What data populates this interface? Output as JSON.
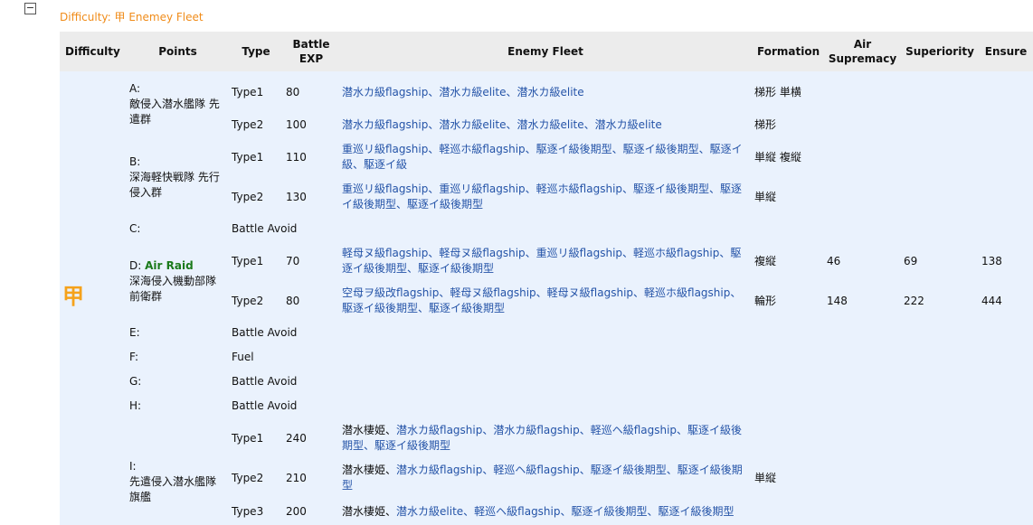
{
  "toggle_symbol": "−",
  "difficulty_title": "Difficulty: 甲 Enemey Fleet",
  "headers": {
    "difficulty": "Difficulty",
    "points": "Points",
    "type": "Type",
    "battle_exp": "Battle EXP",
    "enemy_fleet": "Enemy Fleet",
    "formation": "Formation",
    "air_supremacy": "Air Supremacy",
    "superiority": "Superiority",
    "ensure": "Ensure"
  },
  "difficulty_label": "甲",
  "points": {
    "A": {
      "line1": "A:",
      "name": "敵侵入潜水艦隊 先遣群"
    },
    "B": {
      "line1": "B:",
      "name": "深海軽快戦隊 先行侵入群"
    },
    "C": {
      "line1": "C:"
    },
    "D": {
      "line1": "D:",
      "tag": "Air Raid",
      "name": "深海侵入機動部隊 前衛群"
    },
    "E": {
      "line1": "E:"
    },
    "F": {
      "line1": "F:"
    },
    "G": {
      "line1": "G:"
    },
    "H": {
      "line1": "H:"
    },
    "I": {
      "line1": "I:",
      "name": "先遣侵入潜水艦隊 旗艦"
    }
  },
  "rows": {
    "a1": {
      "type": "Type1",
      "exp": "80",
      "fleet": "潜水カ級flagship、潜水カ級elite、潜水カ級elite",
      "formation": "梯形 単横"
    },
    "a2": {
      "type": "Type2",
      "exp": "100",
      "fleet": "潜水カ級flagship、潜水カ級elite、潜水カ級elite、潜水カ級elite",
      "formation": "梯形"
    },
    "b1": {
      "type": "Type1",
      "exp": "110",
      "fleet": "重巡リ級flagship、軽巡ホ級flagship、駆逐イ級後期型、駆逐イ級後期型、駆逐イ級、駆逐イ級",
      "formation": "単縦 複縦"
    },
    "b2": {
      "type": "Type2",
      "exp": "130",
      "fleet": "重巡リ級flagship、重巡リ級flagship、軽巡ホ級flagship、駆逐イ級後期型、駆逐イ級後期型、駆逐イ級後期型",
      "formation": "単縦"
    },
    "c": {
      "type": "Battle Avoid"
    },
    "d1": {
      "type": "Type1",
      "exp": "70",
      "fleet": "軽母ヌ級flagship、軽母ヌ級flagship、重巡リ級flagship、軽巡ホ級flagship、駆逐イ級後期型、駆逐イ級後期型",
      "formation": "複縦",
      "air": "46",
      "sup": "69",
      "ens": "138"
    },
    "d2": {
      "type": "Type2",
      "exp": "80",
      "fleet": "空母ヲ級改flagship、軽母ヌ級flagship、軽母ヌ級flagship、軽巡ホ級flagship、駆逐イ級後期型、駆逐イ級後期型",
      "formation": "輪形",
      "air": "148",
      "sup": "222",
      "ens": "444"
    },
    "e": {
      "type": "Battle Avoid"
    },
    "f": {
      "type": "Fuel"
    },
    "g": {
      "type": "Battle Avoid"
    },
    "h": {
      "type": "Battle Avoid"
    },
    "i1": {
      "type": "Type1",
      "exp": "240",
      "fleet_dark": "潜水棲姫、",
      "fleet": "潜水カ級flagship、潜水カ級flagship、軽巡ヘ級flagship、駆逐イ級後期型、駆逐イ級後期型"
    },
    "i2": {
      "type": "Type2",
      "exp": "210",
      "fleet_dark": "潜水棲姫、",
      "fleet": "潜水カ級flagship、軽巡ヘ級flagship、駆逐イ級後期型、駆逐イ級後期型",
      "formation": "単縦"
    },
    "i3": {
      "type": "Type3",
      "exp": "200",
      "fleet_dark": "潜水棲姫、",
      "fleet": "潜水カ級elite、軽巡ヘ級flagship、駆逐イ級後期型、駆逐イ級後期型"
    }
  }
}
